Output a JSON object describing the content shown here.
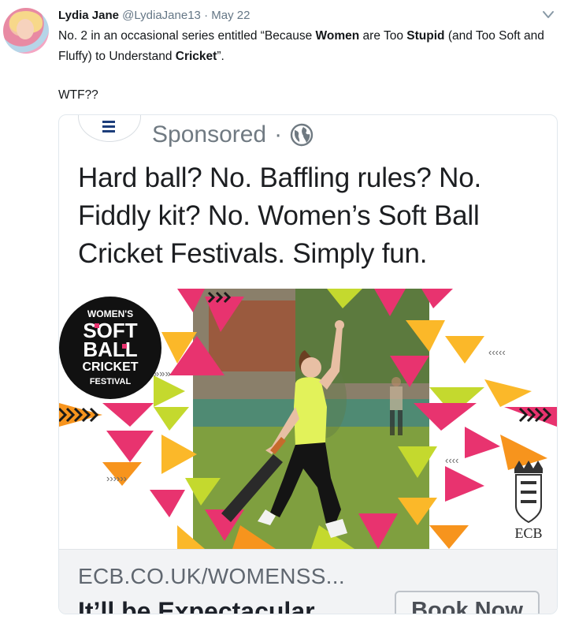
{
  "tweet": {
    "author_name": "Lydia Jane",
    "handle": "@LydiaJane13",
    "separator": "·",
    "date": "May 22",
    "text_parts": [
      {
        "t": "No. 2 in an occasional series entitled “Because "
      },
      {
        "t": "Women",
        "bold": true
      },
      {
        "t": " are Too "
      },
      {
        "t": "Stupid",
        "bold": true
      },
      {
        "t": " (and Too Soft and Fluffy) to Understand "
      },
      {
        "t": "Cricket",
        "bold": true
      },
      {
        "t": "”."
      }
    ],
    "second_line": "WTF??"
  },
  "ad": {
    "sponsored_label": "Sponsored",
    "separator": "·",
    "headline": "Hard ball? No. Baffling rules? No. Fiddly kit? No. Women’s Soft Ball Cricket Festivals. Simply fun.",
    "badge": {
      "line1": "WOMEN'S",
      "line2": "SOFT",
      "line3": "BALL",
      "line4": "CRICKET",
      "line5": "FESTIVAL"
    },
    "ecb_text": "ECB",
    "domain": "ECB.CO.UK/WOMENSS...",
    "link_title": "It’ll be Expectacular",
    "cta_label": "Book Now"
  },
  "colors": {
    "pink": "#e8336f",
    "orange": "#f7941d",
    "yellow": "#fbb829",
    "lime": "#c4d92e",
    "grass": "#7a9a3c",
    "shirt": "#e2f25a"
  }
}
